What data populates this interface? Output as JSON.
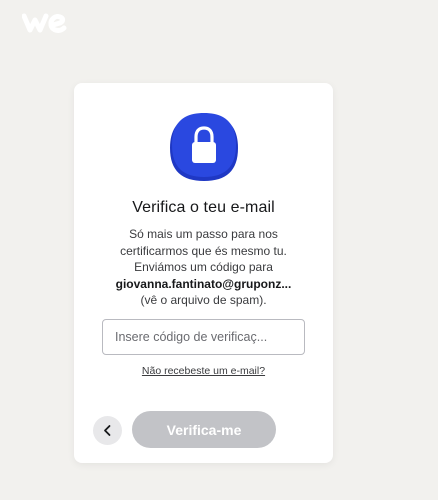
{
  "brand": {
    "logo_icon": "wetransfer-logo-icon",
    "logo_color": "#ffffff"
  },
  "dialog": {
    "lock_icon": "lock-icon",
    "lock_badge_color": "#2a48e0",
    "title": "Verifica o teu e-mail",
    "description_line1": "Só mais um passo para nos",
    "description_line2": "certificarmos que és mesmo tu.",
    "description_line3": "Enviámos um código para",
    "email": "giovanna.fantinato@gruponz...",
    "description_line4": "(vê o arquivo de spam).",
    "code_input": {
      "value": "",
      "placeholder": "Insere código de verificaç..."
    },
    "resend_link": "Não recebeste um e-mail?",
    "back_icon": "chevron-left-icon",
    "verify_button": "Verifica-me",
    "verify_button_color": "#c2c3c7"
  }
}
